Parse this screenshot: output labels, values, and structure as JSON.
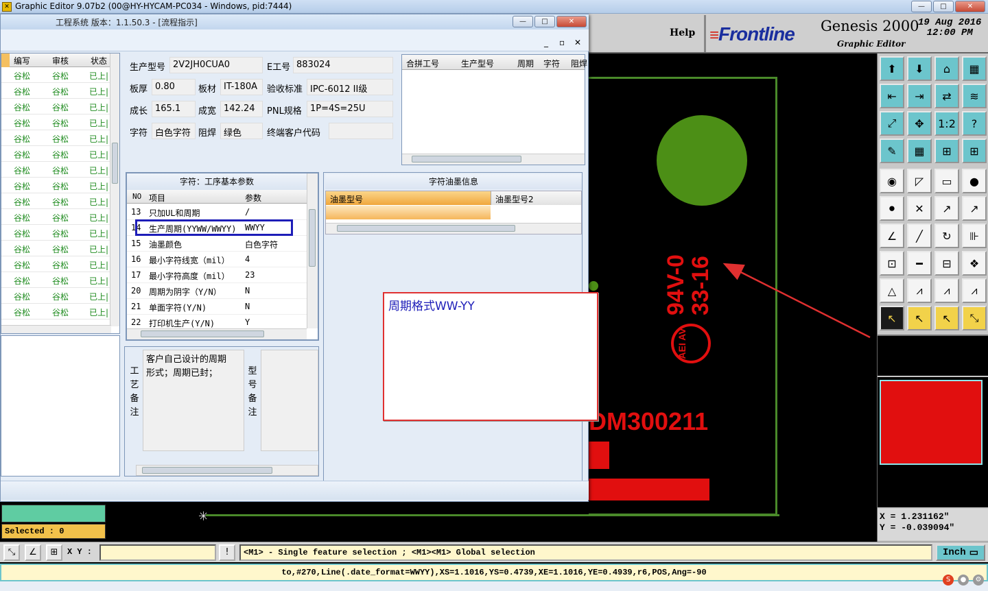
{
  "main_window": {
    "title": "Graphic Editor 9.07b2 (00@HY-HYCAM-PC034 - Windows, pid:7444)",
    "minimize": "—",
    "maximize": "□",
    "close": "✕"
  },
  "genesis": {
    "help": "Help",
    "logo_bars": "≡",
    "logo_text": "Frontline",
    "product": "Genesis 2000",
    "subtitle": "Graphic Editor",
    "date": "19 Aug 2016",
    "time": "12:00 PM"
  },
  "board": {
    "text_ul": "94V-0",
    "text_date": "33-16",
    "text_logo": "AEI AV",
    "text_part": "DM300211"
  },
  "coords": {
    "x": "X  =  1.231162\"",
    "y": "Y  = -0.039094\""
  },
  "selected_label": "Selected : 0",
  "command": {
    "xy_label": "X Y :",
    "xy_value": "",
    "message": "<M1> - Single feature selection ; <M1><M1> Global selection",
    "units": "Inch",
    "units_arrow": "▭"
  },
  "status_line": "to,#270,Line(.date_format=WWYY),XS=1.1016,YS=0.4739,XE=1.1016,YE=0.4939,r6,POS,Ang=-90",
  "dialog": {
    "title": "工程系统   版本：1.1.50.3 - [流程指示]",
    "left_grid": {
      "headers": [
        "编写",
        "审核",
        "状态"
      ],
      "rows": [
        [
          "谷松",
          "谷松",
          "已上|"
        ],
        [
          "谷松",
          "谷松",
          "已上|"
        ],
        [
          "谷松",
          "谷松",
          "已上|"
        ],
        [
          "谷松",
          "谷松",
          "已上|"
        ],
        [
          "谷松",
          "谷松",
          "已上|"
        ],
        [
          "谷松",
          "谷松",
          "已上|"
        ],
        [
          "谷松",
          "谷松",
          "已上|"
        ],
        [
          "谷松",
          "谷松",
          "已上|"
        ],
        [
          "谷松",
          "谷松",
          "已上|"
        ],
        [
          "谷松",
          "谷松",
          "已上|"
        ],
        [
          "谷松",
          "谷松",
          "已上|"
        ],
        [
          "谷松",
          "谷松",
          "已上|"
        ],
        [
          "谷松",
          "谷松",
          "已上|"
        ],
        [
          "谷松",
          "谷松",
          "已上|"
        ],
        [
          "谷松",
          "谷松",
          "已上|"
        ],
        [
          "谷松",
          "谷松",
          "已上|"
        ]
      ]
    },
    "info": {
      "model_label": "生产型号",
      "model_value": "2V2JH0CUA0",
      "eno_label": "E工号",
      "eno_value": "883024",
      "thick_label": "板厚",
      "thick_value": "0.80",
      "material_label": "板材",
      "material_value": "IT-180A",
      "std_label": "验收标准",
      "std_value": "IPC-6012 II级",
      "len_label": "成长",
      "len_value": "165.1",
      "wid_label": "成宽",
      "wid_value": "142.24",
      "pnl_label": "PNL规格",
      "pnl_value": "1P=4S=25U",
      "char_label": "字符",
      "char_value": "白色字符",
      "mask_label": "阻焊",
      "mask_value": "绿色",
      "cust_label": "终端客户代码",
      "cust_value": ""
    },
    "pn_grid": {
      "headers": [
        "合拼工号",
        "生产型号",
        "周期",
        "字符",
        "阻焊"
      ]
    },
    "params": {
      "caption": "字符：工序基本参数",
      "headers": [
        "NO",
        "项目",
        "参数"
      ],
      "rows": [
        [
          "13",
          "只加UL和周期",
          "/"
        ],
        [
          "14",
          "生产周期(YYWW/WWYY)",
          "WWYY"
        ],
        [
          "15",
          "油墨颜色",
          "白色字符"
        ],
        [
          "16",
          "最小字符线宽（mil）",
          "4"
        ],
        [
          "17",
          "最小字符高度（mil）",
          "23"
        ],
        [
          "20",
          "周期为阴字（Y/N）",
          "N"
        ],
        [
          "21",
          "单面字符(Y/N)",
          "N"
        ],
        [
          "22",
          "打印机生产(Y/N)",
          "Y"
        ]
      ]
    },
    "ink": {
      "caption": "字符油墨信息",
      "h1": "油墨型号",
      "h2": "油墨型号2"
    },
    "remarks": {
      "process_label": [
        "工",
        "艺",
        "备",
        "注"
      ],
      "process_text": "客户自己设计的周期形式；周期已封；",
      "model_label": [
        "型",
        "号",
        "备",
        "注"
      ]
    }
  },
  "annotation": {
    "text": "周期格式WW-YY"
  },
  "toolbar": {
    "rows": [
      [
        "⬆",
        "⬇",
        "⌂",
        "▦"
      ],
      [
        "⇤",
        "⇥",
        "⇄",
        "≋"
      ],
      [
        "⤢",
        "✥",
        "1:2",
        "?"
      ],
      [
        "✎",
        "▦",
        "⊞",
        "⊞"
      ],
      [
        "◉",
        "◸",
        "▭",
        "●"
      ],
      [
        "⚫",
        "✕",
        "↗",
        "↗"
      ],
      [
        "∠",
        "╱",
        "↻",
        "⊪"
      ],
      [
        "⊡",
        "━",
        "⊟",
        "❖"
      ],
      [
        "△",
        "⩘",
        "⩘",
        "⩘"
      ],
      [
        "↖",
        "↖",
        "↖",
        "⤡"
      ]
    ]
  }
}
